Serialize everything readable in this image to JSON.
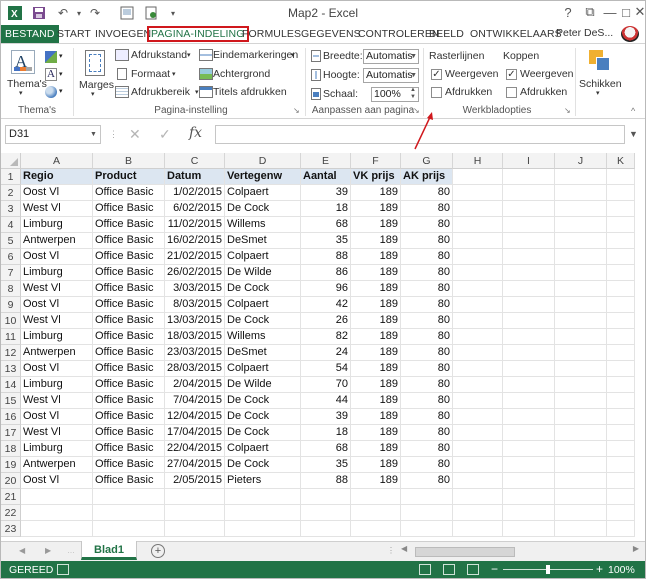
{
  "window": {
    "title": "Map2 - Excel",
    "colors": {
      "accent": "#217346",
      "highlight": "#d0181d",
      "header_fill": "#dce6f1"
    }
  },
  "tabs": [
    {
      "label": "BESTAND"
    },
    {
      "label": "START"
    },
    {
      "label": "INVOEGEN"
    },
    {
      "label": "PAGINA-INDELING"
    },
    {
      "label": "FORMULES"
    },
    {
      "label": "GEGEVENS"
    },
    {
      "label": "CONTROLEREN"
    },
    {
      "label": "BEELD"
    },
    {
      "label": "ONTWIKKELAARS"
    }
  ],
  "user": {
    "name": "Peter DeS..."
  },
  "ribbon": {
    "themes": {
      "button": "Thema's",
      "group": "Thema's"
    },
    "page_setup": {
      "margins": "Marges",
      "orientation": "Afdrukstand",
      "size": "Formaat",
      "print_area": "Afdrukbereik",
      "breaks": "Eindemarkeringen",
      "background": "Achtergrond",
      "print_titles": "Titels afdrukken",
      "group": "Pagina-instelling"
    },
    "scale_to_fit": {
      "width_label": "Breedte:",
      "width_value": "Automatis",
      "height_label": "Hoogte:",
      "height_value": "Automatis",
      "scale_label": "Schaal:",
      "scale_value": "100%",
      "group": "Aanpassen aan pagina"
    },
    "sheet_options": {
      "gridlines": "Rasterlijnen",
      "headings": "Koppen",
      "view": "Weergeven",
      "print": "Afdrukken",
      "group": "Werkbladopties"
    },
    "arrange": {
      "button": "Schikken"
    }
  },
  "formula_bar": {
    "name_box": "D31",
    "fx": "fx"
  },
  "columns": [
    "A",
    "B",
    "C",
    "D",
    "E",
    "F",
    "G",
    "H",
    "I",
    "J",
    "K"
  ],
  "table": {
    "headers": [
      "Regio",
      "Product",
      "Datum",
      "Vertegenw",
      "Aantal",
      "VK prijs",
      "AK prijs"
    ],
    "rows": [
      [
        "Oost Vl",
        "Office Basic",
        "1/02/2015",
        "Colpaert",
        "39",
        "189",
        "80"
      ],
      [
        "West Vl",
        "Office Basic",
        "6/02/2015",
        "De Cock",
        "18",
        "189",
        "80"
      ],
      [
        "Limburg",
        "Office Basic",
        "11/02/2015",
        "Willems",
        "68",
        "189",
        "80"
      ],
      [
        "Antwerpen",
        "Office Basic",
        "16/02/2015",
        "DeSmet",
        "35",
        "189",
        "80"
      ],
      [
        "Oost Vl",
        "Office Basic",
        "21/02/2015",
        "Colpaert",
        "88",
        "189",
        "80"
      ],
      [
        "Limburg",
        "Office Basic",
        "26/02/2015",
        "De Wilde",
        "86",
        "189",
        "80"
      ],
      [
        "West Vl",
        "Office Basic",
        "3/03/2015",
        "De Cock",
        "96",
        "189",
        "80"
      ],
      [
        "Oost Vl",
        "Office Basic",
        "8/03/2015",
        "Colpaert",
        "42",
        "189",
        "80"
      ],
      [
        "West Vl",
        "Office Basic",
        "13/03/2015",
        "De Cock",
        "26",
        "189",
        "80"
      ],
      [
        "Limburg",
        "Office Basic",
        "18/03/2015",
        "Willems",
        "82",
        "189",
        "80"
      ],
      [
        "Antwerpen",
        "Office Basic",
        "23/03/2015",
        "DeSmet",
        "24",
        "189",
        "80"
      ],
      [
        "Oost Vl",
        "Office Basic",
        "28/03/2015",
        "Colpaert",
        "54",
        "189",
        "80"
      ],
      [
        "Limburg",
        "Office Basic",
        "2/04/2015",
        "De Wilde",
        "70",
        "189",
        "80"
      ],
      [
        "West Vl",
        "Office Basic",
        "7/04/2015",
        "De Cock",
        "44",
        "189",
        "80"
      ],
      [
        "Oost Vl",
        "Office Basic",
        "12/04/2015",
        "De Cock",
        "39",
        "189",
        "80"
      ],
      [
        "West Vl",
        "Office Basic",
        "17/04/2015",
        "De Cock",
        "18",
        "189",
        "80"
      ],
      [
        "Limburg",
        "Office Basic",
        "22/04/2015",
        "Colpaert",
        "68",
        "189",
        "80"
      ],
      [
        "Antwerpen",
        "Office Basic",
        "27/04/2015",
        "De Cock",
        "35",
        "189",
        "80"
      ],
      [
        "Oost Vl",
        "Office Basic",
        "2/05/2015",
        "Pieters",
        "88",
        "189",
        "80"
      ]
    ]
  },
  "row_numbers": [
    "1",
    "2",
    "3",
    "4",
    "5",
    "6",
    "7",
    "8",
    "9",
    "10",
    "11",
    "12",
    "13",
    "14",
    "15",
    "16",
    "17",
    "18",
    "19",
    "20",
    "21",
    "22",
    "23"
  ],
  "sheet": {
    "tab": "Blad1"
  },
  "status": {
    "text": "GEREED",
    "zoom": "100%"
  }
}
